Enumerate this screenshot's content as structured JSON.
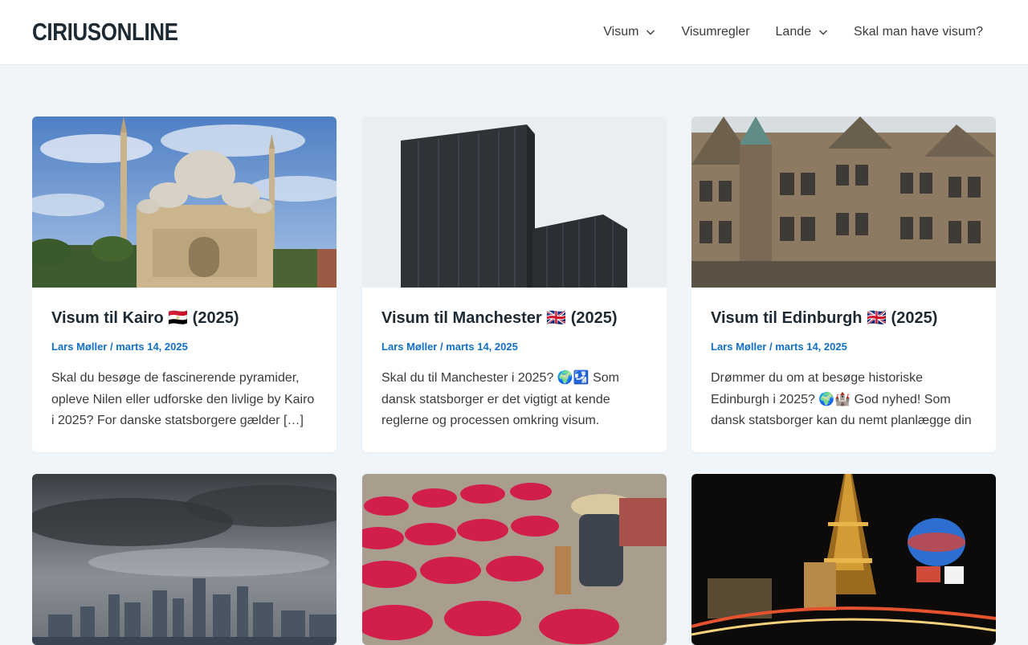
{
  "site": {
    "logo": "CIRIUSONLINE"
  },
  "nav": {
    "items": [
      {
        "label": "Visum",
        "dropdown": true
      },
      {
        "label": "Visumregler",
        "dropdown": false
      },
      {
        "label": "Lande",
        "dropdown": true
      },
      {
        "label": "Skal man have visum?",
        "dropdown": false
      }
    ]
  },
  "posts": [
    {
      "title": "Visum til Kairo 🇪🇬 (2025)",
      "author": "Lars Møller",
      "separator": " / ",
      "date": "marts 14, 2025",
      "excerpt": "Skal du besøge de fascinerende pyramider, opleve Nilen eller udforske den livlige by Kairo i 2025? For danske statsborgere gælder […]"
    },
    {
      "title": "Visum til Manchester 🇬🇧 (2025)",
      "author": "Lars Møller",
      "separator": " / ",
      "date": "marts 14, 2025",
      "excerpt": "Skal du til Manchester i 2025? 🌍🛂 Som dansk statsborger er det vigtigt at kende reglerne og processen omkring visum."
    },
    {
      "title": "Visum til Edinburgh 🇬🇧 (2025)",
      "author": "Lars Møller",
      "separator": " / ",
      "date": "marts 14, 2025",
      "excerpt": "Drømmer du om at besøge historiske Edinburgh i 2025? 🌍🏰 God nyhed! Som dansk statsborger kan du nemt planlægge din"
    }
  ],
  "colors": {
    "accent": "#1370c7",
    "background": "#f0f5fa",
    "heading": "#1e2a33"
  }
}
